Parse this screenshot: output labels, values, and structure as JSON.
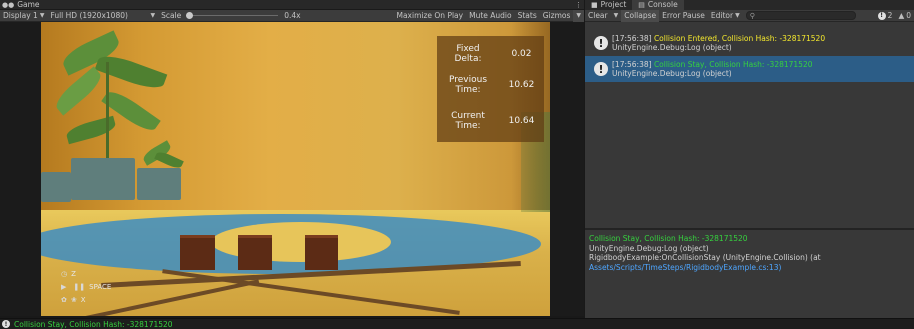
{
  "game": {
    "tab_label": "Game",
    "display": "Display 1",
    "resolution": "Full HD (1920x1080)",
    "scale_label": "Scale",
    "scale_value": "0.4x",
    "scale_fraction": 0.0,
    "maximize": "Maximize On Play",
    "mute": "Mute Audio",
    "stats": "Stats",
    "gizmos": "Gizmos",
    "info": [
      {
        "label": "Fixed\nDelta:",
        "value": "0.02"
      },
      {
        "label": "Previous\nTime:",
        "value": "10.62"
      },
      {
        "label": "Current\nTime:",
        "value": "10.64"
      }
    ],
    "controls": {
      "z_key": "Z",
      "space_key": "SPACE",
      "x_key": "X"
    }
  },
  "console": {
    "tab_project": "Project",
    "tab_console": "Console",
    "clear": "Clear",
    "collapse": "Collapse",
    "error_pause": "Error Pause",
    "editor": "Editor",
    "search_placeholder": "",
    "warn_count": "2",
    "error_count": "0",
    "logs": [
      {
        "time": "[17:56:38]",
        "message": "Collision Entered, Collision Hash: -328171520",
        "source": "UnityEngine.Debug:Log (object)"
      },
      {
        "time": "[17:56:38]",
        "message": "Collision Stay, Collision Hash: -328171520",
        "source": "UnityEngine.Debug:Log (object)"
      }
    ],
    "detail": {
      "line1": "Collision Stay, Collision Hash: -328171520",
      "line2": "UnityEngine.Debug:Log (object)",
      "line3": "RigidbodyExample:OnCollisionStay (UnityEngine.Collision) (at",
      "line4": "Assets/Scripts/TimeSteps/RigidbodyExample.cs:13)"
    }
  },
  "status_bar": {
    "text": "Collision Stay, Collision Hash: -328171520"
  },
  "colors": {
    "log_yellow": "#f5e92d",
    "log_green": "#36d13f",
    "selected_row": "#2c5d87",
    "link": "#4ea6ff"
  }
}
